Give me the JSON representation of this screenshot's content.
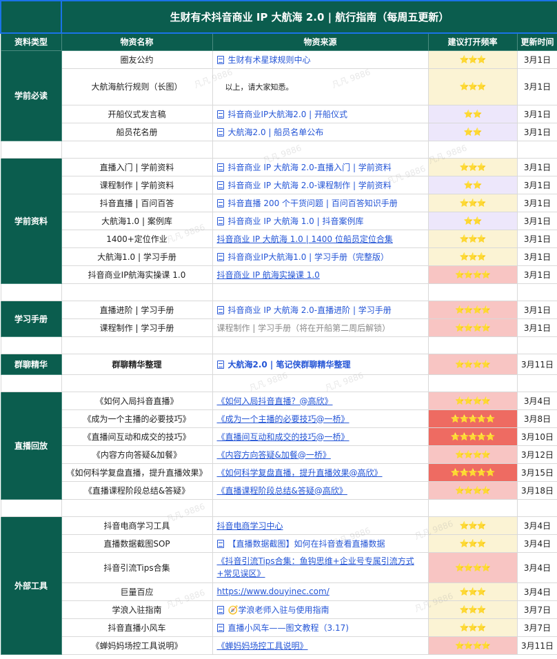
{
  "title": "生财有术抖音商业 IP 大航海 2.0 | 航行指南（每周五更新）",
  "headers": {
    "type": "资料类型",
    "name": "物资名称",
    "source": "物资来源",
    "freq": "建议打开频率",
    "date": "更新时间"
  },
  "sections": [
    {
      "label": "学前必读",
      "rows": [
        {
          "name": "圈友公约",
          "source": "生财有术星球规则中心",
          "style": "doc",
          "rating": 3,
          "date": "3月1日"
        },
        {
          "name": "大航海航行规则（长图）",
          "source": "以上，请大家知悉。",
          "style": "black",
          "rating": 3,
          "date": "3月1日"
        },
        {
          "name": "开船仪式发言稿",
          "source": "抖音商业IP大航海2.0 | 开船仪式",
          "style": "doc",
          "rating": 2,
          "date": "3月1日"
        },
        {
          "name": "船员花名册",
          "source": "大航海2.0 | 船员名单公布",
          "style": "doc",
          "rating": 2,
          "date": "3月1日"
        }
      ]
    },
    {
      "label": "学前资料",
      "rows": [
        {
          "name": "直播入门 | 学前资料",
          "source": "抖音商业 IP 大航海 2.0-直播入门 | 学前资料",
          "style": "doc",
          "rating": 3,
          "date": "3月1日"
        },
        {
          "name": "课程制作 | 学前资料",
          "source": "抖音商业 IP 大航海 2.0-课程制作 | 学前资料",
          "style": "doc",
          "rating": 2,
          "date": "3月1日"
        },
        {
          "name": "抖音直播 | 百问百答",
          "source": "抖音直播 200 个干货问题 | 百问百答知识手册",
          "style": "doc",
          "rating": 3,
          "date": "3月1日"
        },
        {
          "name": "大航海1.0 | 案例库",
          "source": "抖音商业 IP 大航海 1.0 | 抖音案例库",
          "style": "doc",
          "rating": 2,
          "date": "3月1日"
        },
        {
          "name": "1400+定位作业",
          "source": "抖音商业 IP 大航海 1.0 | 1400 位船员定位合集",
          "style": "link",
          "rating": 3,
          "date": "3月1日"
        },
        {
          "name": "大航海1.0 | 学习手册",
          "source": "抖音商业IP大航海1.0 | 学习手册（完整版）",
          "style": "doc",
          "rating": 3,
          "date": "3月1日"
        },
        {
          "name": "抖音商业IP航海实操课 1.0",
          "source": "抖音商业 IP 航海实操课 1.0",
          "style": "link",
          "rating": 4,
          "date": "3月1日"
        }
      ]
    },
    {
      "label": "学习手册",
      "rows": [
        {
          "name": "直播进阶 | 学习手册",
          "source": "抖音商业 IP 大航海 2.0-直播进阶 | 学习手册",
          "style": "doc",
          "rating": 4,
          "date": "3月1日"
        },
        {
          "name": "课程制作 | 学习手册",
          "source": "课程制作 | 学习手册（将在开船第二周后解锁）",
          "style": "plain",
          "rating": 4,
          "date": "3月1日"
        }
      ]
    },
    {
      "label": "群聊精华",
      "rows": [
        {
          "name": "群聊精华整理",
          "source": "大航海2.0 | 笔记侠群聊精华整理",
          "style": "doc-bold",
          "rating": 4,
          "date": "3月11日",
          "bold": true
        }
      ]
    },
    {
      "label": "直播回放",
      "rows": [
        {
          "name": "《如何入局抖音直播》",
          "source": "《如何入局抖音直播？@高欣》",
          "style": "link",
          "rating": 4,
          "date": "3月4日"
        },
        {
          "name": "《成为一个主播的必要技巧》",
          "source": "《成为一个主播的必要技巧@一桥》",
          "style": "link",
          "rating": 5,
          "date": "3月8日"
        },
        {
          "name": "《直播间互动和成交的技巧》",
          "source": "《直播间互动和成交的技巧@一桥》",
          "style": "link",
          "rating": 5,
          "date": "3月10日"
        },
        {
          "name": "《内容方向答疑&加餐》",
          "source": "《内容方向答疑&加餐@一桥》",
          "style": "link",
          "rating": 4,
          "date": "3月12日"
        },
        {
          "name": "《如何科学复盘直播，提升直播效果》",
          "source": "《如何科学复盘直播，提升直播效果@高欣》",
          "style": "link",
          "rating": 5,
          "date": "3月15日"
        },
        {
          "name": "《直播课程阶段总结&答疑》",
          "source": "《直播课程阶段总结&答疑@高欣》",
          "style": "link",
          "rating": 4,
          "date": "3月18日"
        }
      ]
    },
    {
      "label": "外部工具",
      "rows": [
        {
          "name": "抖音电商学习工具",
          "source": "抖音电商学习中心",
          "style": "link",
          "rating": 3,
          "date": "3月4日"
        },
        {
          "name": "直播数据截图SOP",
          "source": "【直播数据截图】如何在抖音查看直播数据",
          "style": "doc",
          "rating": 3,
          "date": "3月4日"
        },
        {
          "name": "抖音引流Tips合集",
          "source": "《抖音引流Tips合集：鱼钩思维+企业号专属引流方式+常见误区》",
          "style": "link-wrap",
          "rating": 4,
          "date": "3月4日"
        },
        {
          "name": "巨量百应",
          "source": "https://www.douyinec.com/",
          "style": "link",
          "rating": 3,
          "date": "3月4日"
        },
        {
          "name": "学浪入驻指南",
          "source": "🧭学浪老师入驻与使用指南",
          "style": "doc",
          "rating": 3,
          "date": "3月7日"
        },
        {
          "name": "抖音直播小风车",
          "source": "直播小风车——图文教程（3.17)",
          "style": "doc",
          "rating": 3,
          "date": "3月7日"
        },
        {
          "name": "《蝉妈妈场控工具说明》",
          "source": "《蝉妈妈场控工具说明》",
          "style": "link",
          "rating": 4,
          "date": "3月11日"
        }
      ]
    }
  ],
  "watermark": "凡凡 9886",
  "colors": {
    "header_bg": "#0b5d4e",
    "rating2": "#ede7fb",
    "rating3": "#fbf3d4",
    "rating4": "#f8c5c3",
    "rating5": "#ee6b62",
    "link": "#2455d6"
  }
}
